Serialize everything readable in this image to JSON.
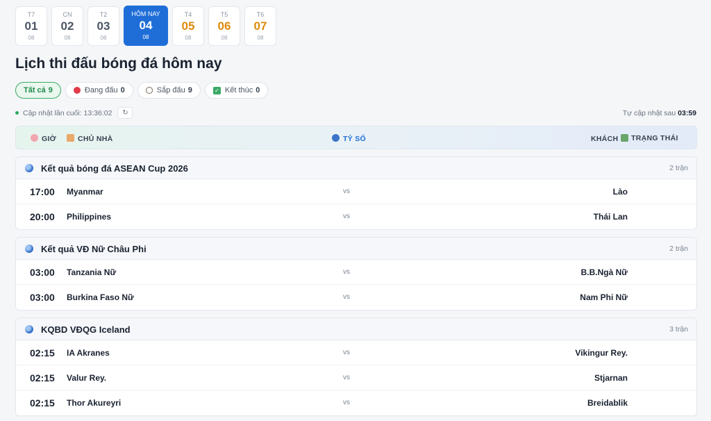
{
  "dates": [
    {
      "dow": "T7",
      "num": "01",
      "mon": "08",
      "state": "past"
    },
    {
      "dow": "CN",
      "num": "02",
      "mon": "08",
      "state": "past"
    },
    {
      "dow": "T2",
      "num": "03",
      "mon": "08",
      "state": "past"
    },
    {
      "dow": "HÔM NAY",
      "num": "04",
      "mon": "08",
      "state": "active"
    },
    {
      "dow": "T4",
      "num": "05",
      "mon": "08",
      "state": "future"
    },
    {
      "dow": "T5",
      "num": "06",
      "mon": "08",
      "state": "future"
    },
    {
      "dow": "T6",
      "num": "07",
      "mon": "08",
      "state": "future"
    }
  ],
  "title": "Lịch thi đấu bóng đá hôm nay",
  "filters": [
    {
      "label": "Tất cả",
      "count": "9",
      "icon": "",
      "active": true
    },
    {
      "label": "Đang đấu",
      "count": "0",
      "icon": "live-dot-icon",
      "active": false
    },
    {
      "label": "Sắp đấu",
      "count": "9",
      "icon": "clock-icon",
      "active": false
    },
    {
      "label": "Kết thúc",
      "count": "0",
      "icon": "check-icon",
      "active": false
    }
  ],
  "update": {
    "last_label": "Cập nhật lần cuối: 13:36:02",
    "refresh_icon": "↻",
    "auto_label": "Tự cập nhật sau",
    "auto_value": "03:59"
  },
  "header": {
    "time": "GIỜ",
    "home": "CHỦ NHÀ",
    "score": "TỶ SỐ",
    "away": "KHÁCH",
    "status": "TRẠNG THÁI"
  },
  "groups": [
    {
      "title": "Kết quả bóng đá ASEAN Cup 2026",
      "count": "2 trận",
      "matches": [
        {
          "time": "17:00",
          "home": "Myanmar",
          "vs": "vs",
          "away": "Lào"
        },
        {
          "time": "20:00",
          "home": "Philippines",
          "vs": "vs",
          "away": "Thái Lan"
        }
      ]
    },
    {
      "title": "Kết quả VĐ Nữ Châu Phi",
      "count": "2 trận",
      "matches": [
        {
          "time": "03:00",
          "home": "Tanzania Nữ",
          "vs": "vs",
          "away": "B.B.Ngà Nữ"
        },
        {
          "time": "03:00",
          "home": "Burkina Faso Nữ",
          "vs": "vs",
          "away": "Nam Phi Nữ"
        }
      ]
    },
    {
      "title": "KQBD VĐQG Iceland",
      "count": "3 trận",
      "matches": [
        {
          "time": "02:15",
          "home": "IA Akranes",
          "vs": "vs",
          "away": "Vikingur Rey."
        },
        {
          "time": "02:15",
          "home": "Valur Rey.",
          "vs": "vs",
          "away": "Stjarnan"
        },
        {
          "time": "02:15",
          "home": "Thor Akureyri",
          "vs": "vs",
          "away": "Breidablik"
        }
      ]
    }
  ],
  "colors": {
    "accent": "#1f6ed8",
    "future": "#e08a0b",
    "live": "#e23b4a",
    "success": "#3aa966"
  }
}
